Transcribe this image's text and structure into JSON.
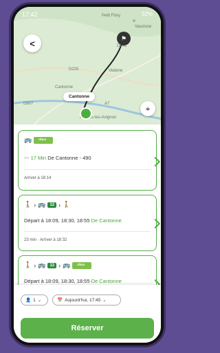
{
  "status": {
    "time": "17:42",
    "battery": "52%"
  },
  "map": {
    "labels": [
      "Petit Flory",
      "D942",
      "Vedene",
      "D225",
      "D907",
      "A7",
      "Cantonne",
      "Altières-les-Avignon",
      "Vaucluse"
    ],
    "city_bubble": "Cantonne"
  },
  "cards": [
    {
      "logo_text": "rlbus",
      "live_label": "17 Min",
      "from_text": "De Cantonne - 490",
      "footer": "Arriver à 18:14"
    },
    {
      "bus_number": "12",
      "departure": "Départ à 18:09, 18:30, 18:55",
      "from": "De Cantonne",
      "footer": "23 min  ·  Arriver à 18:32"
    },
    {
      "bus_number": "12",
      "logo_text": "rlbus",
      "departure": "Départ à 18:09, 18:30, 18:55",
      "from": "De Cantonne"
    }
  ],
  "controls": {
    "passengers": "1",
    "datetime": "Aujourd'hui, 17:45",
    "reserve_label": "Réserver"
  },
  "colors": {
    "accent": "#5cb14a",
    "card_border": "#52b045",
    "background": "#5f4d93"
  }
}
